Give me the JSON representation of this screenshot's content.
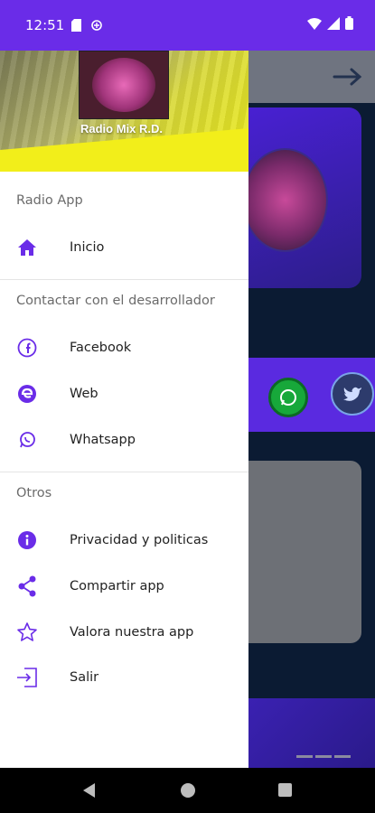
{
  "status_bar": {
    "time": "12:51"
  },
  "drawer": {
    "header_title": "Radio Mix R.D.",
    "sections": {
      "app": {
        "label": "Radio App",
        "items": [
          {
            "label": "Inicio",
            "icon": "home-icon"
          }
        ]
      },
      "contact": {
        "label": "Contactar con el desarrollador",
        "items": [
          {
            "label": "Facebook",
            "icon": "facebook-icon"
          },
          {
            "label": "Web",
            "icon": "web-icon"
          },
          {
            "label": "Whatsapp",
            "icon": "whatsapp-icon"
          }
        ]
      },
      "others": {
        "label": "Otros",
        "items": [
          {
            "label": "Privacidad y politicas",
            "icon": "info-icon"
          },
          {
            "label": "Compartir app",
            "icon": "share-icon"
          },
          {
            "label": "Valora nuestra app",
            "icon": "star-icon"
          },
          {
            "label": "Salir",
            "icon": "exit-icon"
          }
        ]
      }
    }
  },
  "colors": {
    "accent": "#6a2ce8",
    "drawer_bg": "#ffffff",
    "app_bg": "#0b1b33"
  }
}
